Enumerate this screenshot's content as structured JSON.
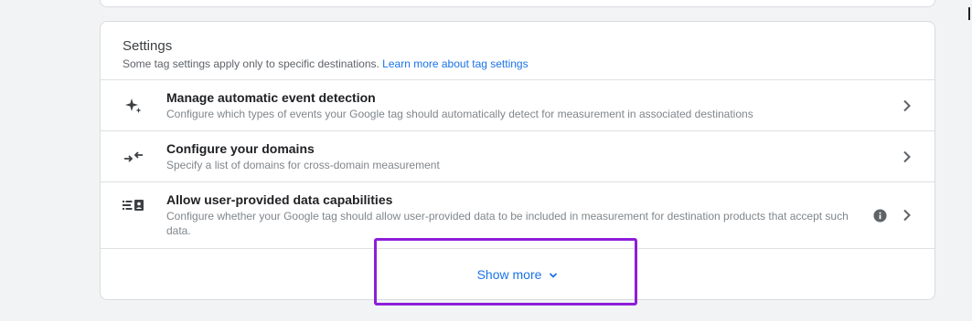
{
  "settings": {
    "title": "Settings",
    "subtitle": "Some tag settings apply only to specific destinations.",
    "learn_more_label": "Learn more about tag settings",
    "items": [
      {
        "icon": "sparkle-icon",
        "title": "Manage automatic event detection",
        "description": "Configure which types of events your Google tag should automatically detect for measurement in associated destinations"
      },
      {
        "icon": "arrows-inward-icon",
        "title": "Configure your domains",
        "description": "Specify a list of domains for cross-domain measurement"
      },
      {
        "icon": "data-list-icon",
        "title": "Allow user-provided data capabilities",
        "description": "Configure whether your Google tag should allow user-provided data to be included in measurement for destination products that accept such data."
      }
    ],
    "show_more_label": "Show more"
  },
  "colors": {
    "accent": "#1a73e8",
    "highlight": "#8d1ed8",
    "background": "#f1f3f4"
  }
}
